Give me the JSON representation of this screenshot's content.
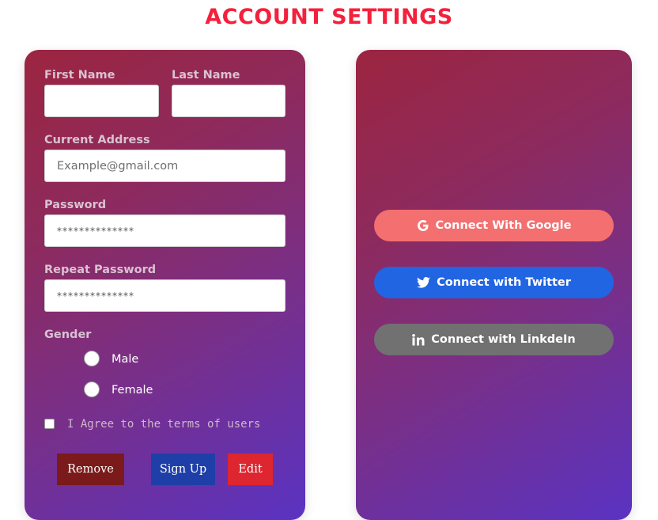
{
  "page": {
    "title": "ACCOUNT SETTINGS"
  },
  "form": {
    "first_name": {
      "label": "First Name",
      "value": "",
      "placeholder": ""
    },
    "last_name": {
      "label": "Last Name",
      "value": "",
      "placeholder": ""
    },
    "address": {
      "label": "Current Address",
      "value": "",
      "placeholder": "Example@gmail.com"
    },
    "password": {
      "label": "Password",
      "value": "",
      "placeholder": "**************"
    },
    "repeat_password": {
      "label": "Repeat Password",
      "value": "",
      "placeholder": "**************"
    },
    "gender": {
      "label": "Gender",
      "options": [
        {
          "label": "Male",
          "selected": false
        },
        {
          "label": "Female",
          "selected": false
        }
      ]
    },
    "terms": {
      "label": "I Agree to the terms of users",
      "checked": false
    },
    "buttons": {
      "remove": "Remove",
      "signup": "Sign Up",
      "edit": "Edit"
    }
  },
  "social": {
    "google": {
      "label": "Connect With Google",
      "icon": "google-icon",
      "color": "#f36f70"
    },
    "twitter": {
      "label": "Connect with Twitter",
      "icon": "twitter-icon",
      "color": "#2165e3"
    },
    "linkedin": {
      "label": "Connect with LinkdeIn",
      "icon": "linkedin-icon",
      "color": "#717171"
    }
  },
  "colors": {
    "title": "#f4203c",
    "card_gradient_start": "#9c2540",
    "card_gradient_end": "#5a33c2",
    "remove_button": "#7a1a1a",
    "signup_button": "#1f3fa8",
    "edit_button": "#dd2630"
  }
}
